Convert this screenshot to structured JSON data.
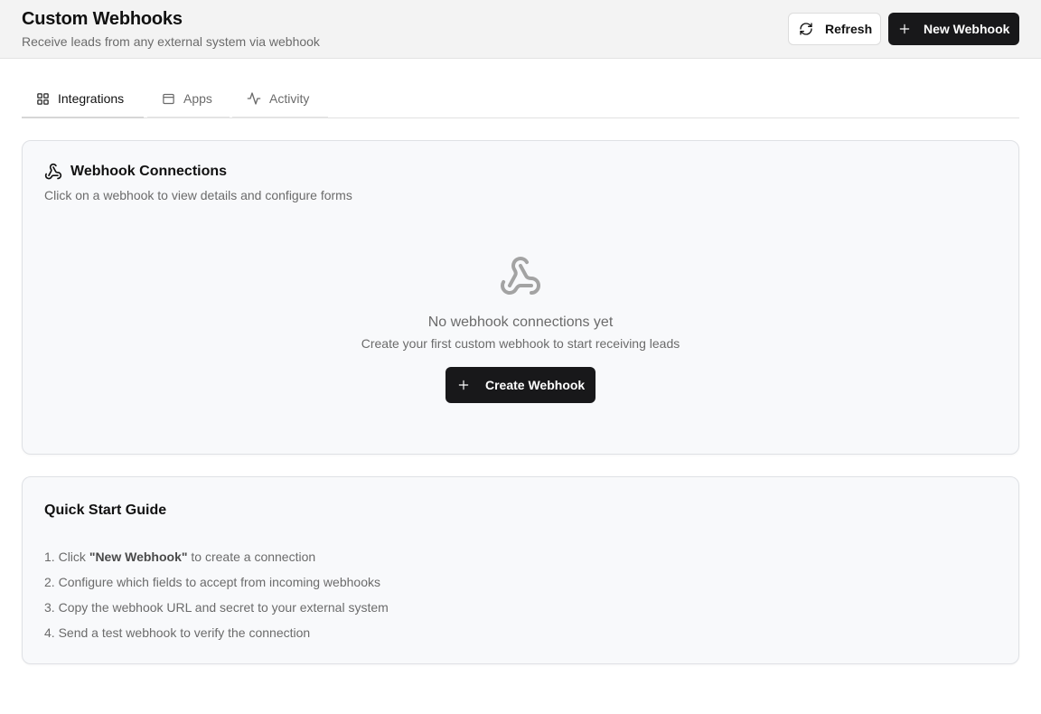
{
  "header": {
    "title": "Custom Webhooks",
    "subtitle": "Receive leads from any external system via webhook",
    "refresh_label": "Refresh",
    "refresh_icon": "refresh-icon",
    "new_label": "New Webhook",
    "new_icon": "plus-icon"
  },
  "tabs": [
    {
      "label": "Integrations",
      "icon": "grid-icon",
      "active": true
    },
    {
      "label": "Apps",
      "icon": "window-icon",
      "active": false
    },
    {
      "label": "Activity",
      "icon": "activity-icon",
      "active": false
    }
  ],
  "connections": {
    "title": "Webhook Connections",
    "icon": "webhook-icon",
    "description": "Click on a webhook to view details and configure forms",
    "empty_title": "No webhook connections yet",
    "empty_subtitle": "Create your first custom webhook to start receiving leads",
    "create_label": "Create Webhook"
  },
  "guide": {
    "title": "Quick Start Guide",
    "steps": [
      {
        "num": "1.",
        "pre": "Click ",
        "bold": "\"New Webhook\"",
        "post": " to create a connection"
      },
      {
        "num": "2.",
        "pre": "Configure which fields to accept from incoming webhooks",
        "bold": "",
        "post": ""
      },
      {
        "num": "3.",
        "pre": "Copy the webhook URL and secret to your external system",
        "bold": "",
        "post": ""
      },
      {
        "num": "4.",
        "pre": "Send a test webhook to verify the connection",
        "bold": "",
        "post": ""
      }
    ]
  },
  "colors": {
    "primary_button": "#18181a",
    "header_bg": "#f3f3f3",
    "card_bg": "#f8f9fb",
    "muted_text": "#6b6b6b"
  }
}
